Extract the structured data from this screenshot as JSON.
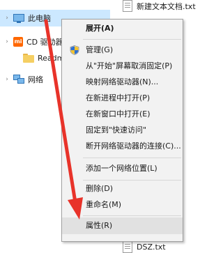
{
  "nav": {
    "items": [
      {
        "label": "此电脑"
      },
      {
        "label": "CD 驱动器 (D:) Xiaomi"
      },
      {
        "label": "Readme"
      },
      {
        "label": "网络"
      }
    ],
    "cd_icon_text": "mi"
  },
  "files": [
    {
      "label": "新建文本文档.txt"
    },
    {
      "label": "DSZ.txt"
    }
  ],
  "context_menu": {
    "items": [
      {
        "label": "展开(A)"
      },
      {
        "label": "管理(G)"
      },
      {
        "label": "从\"开始\"屏幕取消固定(P)"
      },
      {
        "label": "映射网络驱动器(N)..."
      },
      {
        "label": "在新进程中打开(P)"
      },
      {
        "label": "在新窗口中打开(E)"
      },
      {
        "label": "固定到\"快速访问\""
      },
      {
        "label": "断开网络驱动器的连接(C)..."
      },
      {
        "label": "添加一个网络位置(L)"
      },
      {
        "label": "删除(D)"
      },
      {
        "label": "重命名(M)"
      },
      {
        "label": "属性(R)"
      }
    ]
  },
  "colors": {
    "selection": "#cce8ff",
    "menu_bg": "#f2f2f2",
    "menu_hover": "#e1e1e1",
    "annotation": "#e8332a"
  },
  "icons": [
    "computer-icon",
    "xiaomi-icon",
    "folder-icon",
    "network-icon",
    "uac-shield-icon",
    "text-file-icon",
    "chevron-right-icon"
  ]
}
